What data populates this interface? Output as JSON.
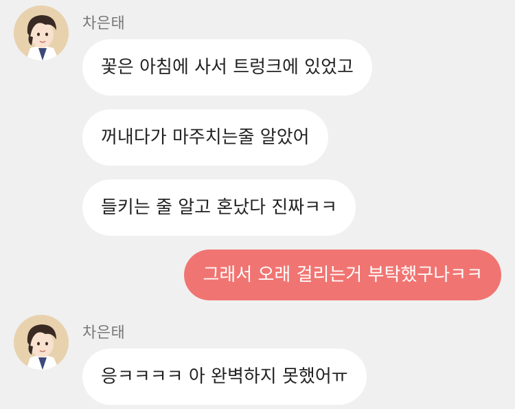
{
  "colors": {
    "background": "#f0f0f0",
    "incoming_bubble": "#ffffff",
    "outgoing_bubble": "#f07572",
    "sender_name": "#777777"
  },
  "groups": [
    {
      "sender": "차은태",
      "messages": [
        "꽃은 아침에 사서 트렁크에 있었고",
        "꺼내다가 마주치는줄 알았어",
        "들키는 줄 알고 혼났다 진짜ㅋㅋ"
      ]
    },
    {
      "sender": "me",
      "messages": [
        "그래서 오래 걸리는거 부탁했구나ㅋㅋ"
      ]
    },
    {
      "sender": "차은태",
      "messages": [
        "응ㅋㅋㅋㅋ 아 완벽하지 못했어ㅠ"
      ]
    }
  ]
}
